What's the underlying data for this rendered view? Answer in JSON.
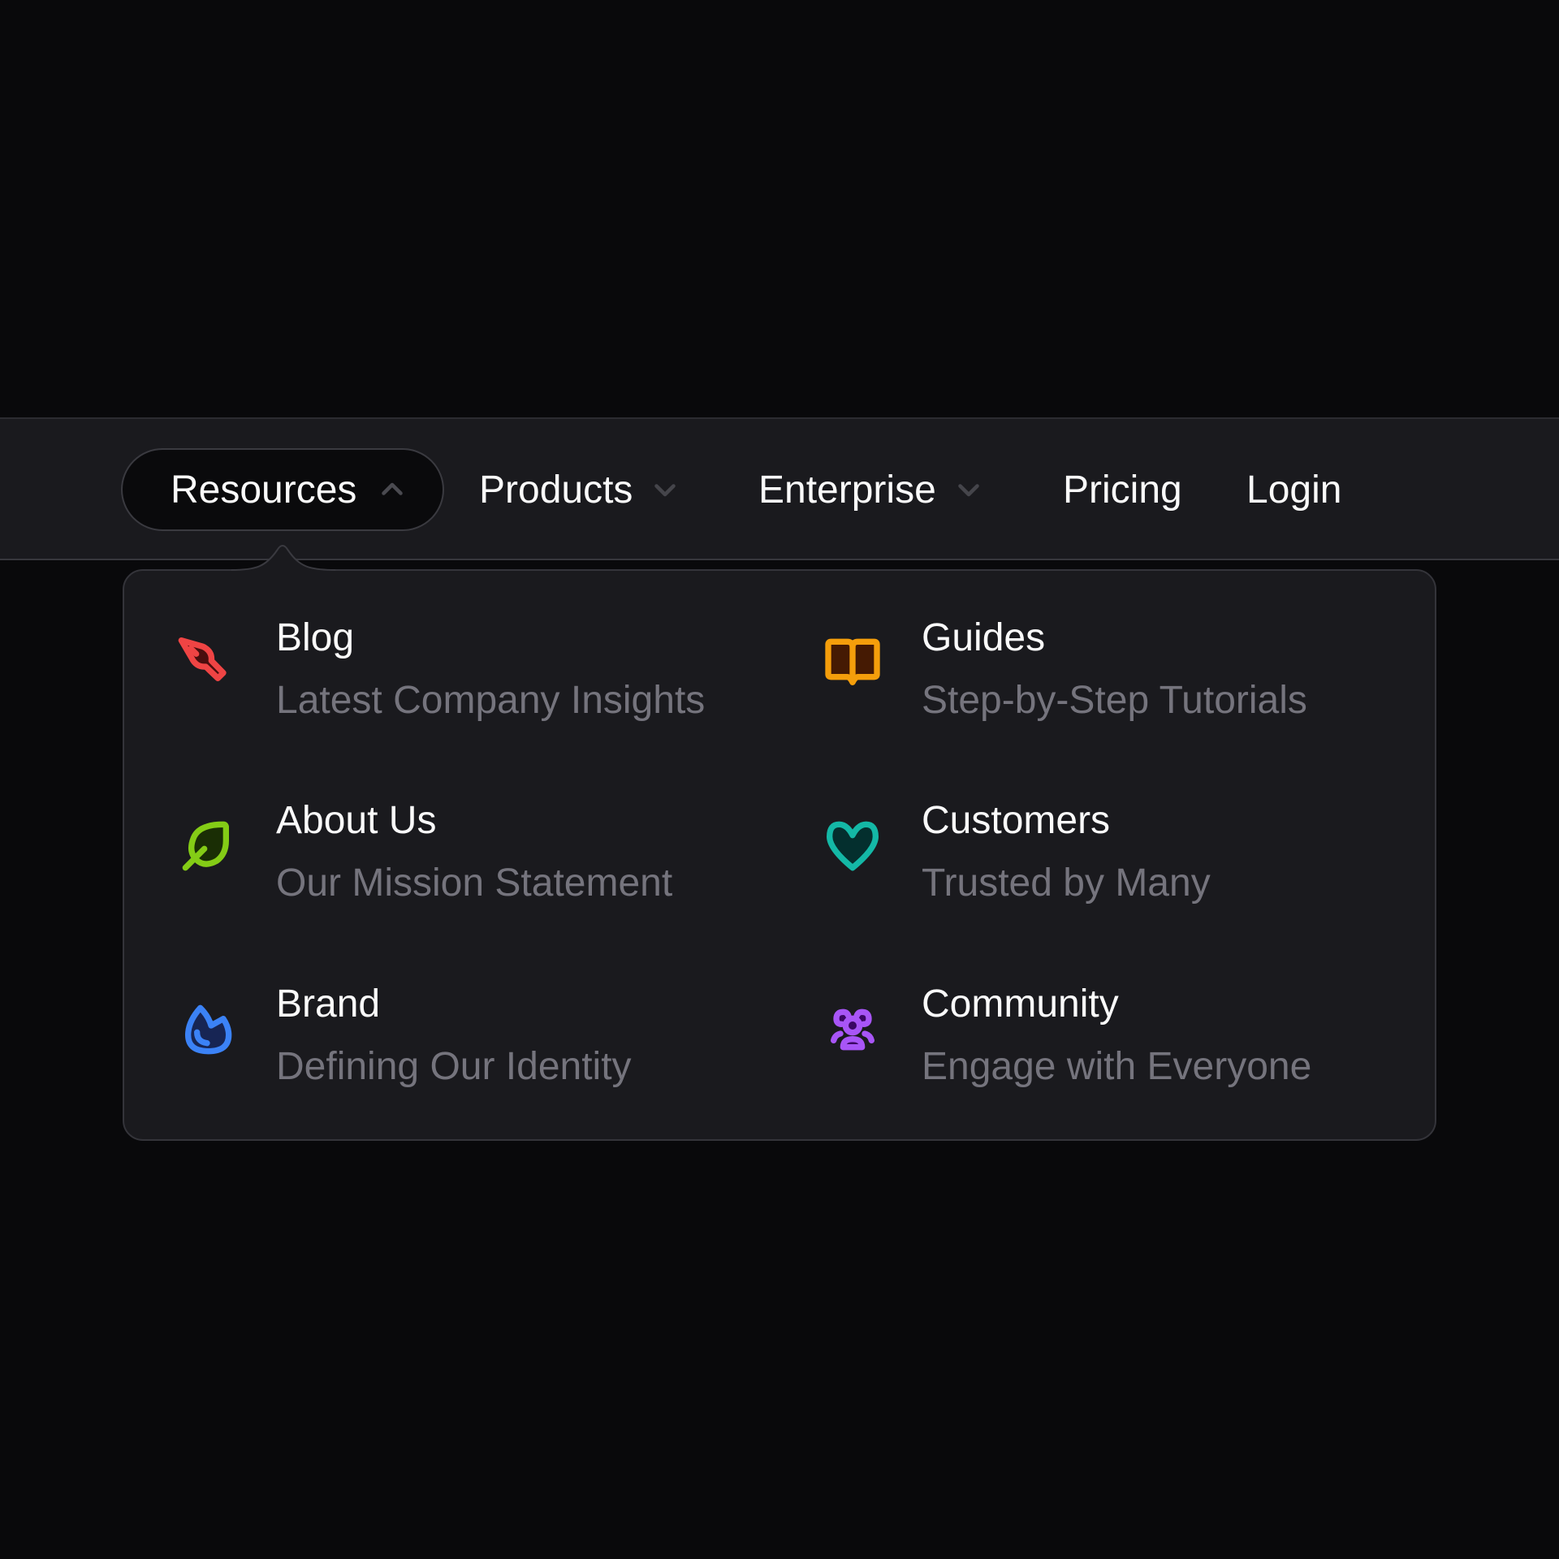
{
  "nav": {
    "items": [
      {
        "label": "Resources",
        "has_dropdown": true,
        "expanded": true,
        "chevron": "chevron-up-icon"
      },
      {
        "label": "Products",
        "has_dropdown": true,
        "expanded": false,
        "chevron": "chevron-down-icon"
      },
      {
        "label": "Enterprise",
        "has_dropdown": true,
        "expanded": false,
        "chevron": "chevron-down-icon"
      },
      {
        "label": "Pricing",
        "has_dropdown": false
      },
      {
        "label": "Login",
        "has_dropdown": false
      }
    ]
  },
  "dropdown": {
    "items": [
      {
        "title": "Blog",
        "subtitle": "Latest Company Insights",
        "icon": "pen-nib-icon",
        "color": "#ef4444",
        "fill": "#4a0e0e"
      },
      {
        "title": "Guides",
        "subtitle": "Step-by-Step Tutorials",
        "icon": "book-open-icon",
        "color": "#f59e0b",
        "fill": "#451a03"
      },
      {
        "title": "About Us",
        "subtitle": "Our Mission Statement",
        "icon": "leaf-icon",
        "color": "#84cc16",
        "fill": "#1a2e05"
      },
      {
        "title": "Customers",
        "subtitle": "Trusted by Many",
        "icon": "heart-icon",
        "color": "#14b8a6",
        "fill": "#042f2e"
      },
      {
        "title": "Brand",
        "subtitle": "Defining Our Identity",
        "icon": "flame-icon",
        "color": "#3b82f6",
        "fill": "#172554"
      },
      {
        "title": "Community",
        "subtitle": "Engage with Everyone",
        "icon": "users-icon",
        "color": "#a855f7",
        "fill": "#3b0764"
      }
    ]
  }
}
